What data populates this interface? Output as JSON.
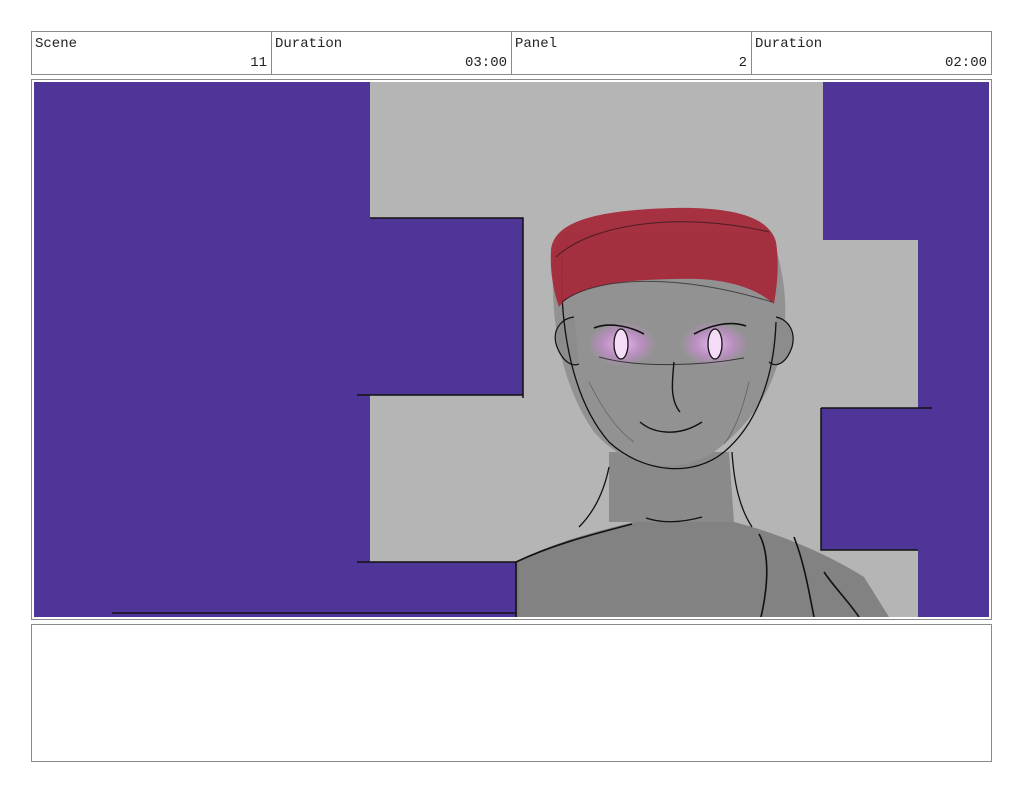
{
  "header": {
    "scene_label": "Scene",
    "scene_value": "11",
    "scene_duration_label": "Duration",
    "scene_duration_value": "03:00",
    "panel_label": "Panel",
    "panel_value": "2",
    "panel_duration_label": "Duration",
    "panel_duration_value": "02:00"
  },
  "colors": {
    "wall_purple": "#4f3598",
    "background_gray": "#b5b5b5",
    "hair_red": "#a52a3a",
    "eye_glow": "#d58ce0",
    "skin_gray": "#8c8c8c"
  },
  "notes": {
    "text": ""
  }
}
